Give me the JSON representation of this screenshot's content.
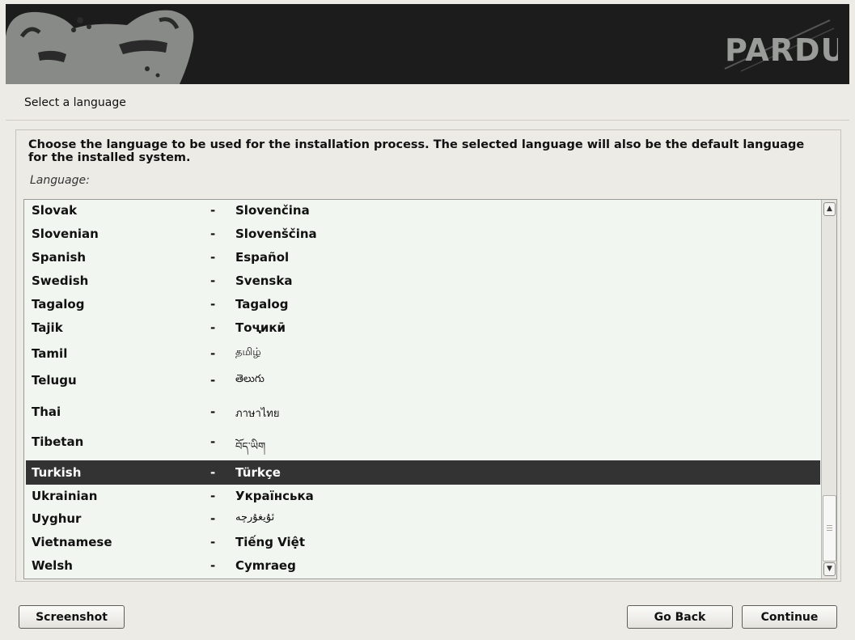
{
  "header": {
    "brand": "PARDUS"
  },
  "page": {
    "title": "Select a language"
  },
  "main": {
    "description": "Choose the language to be used for the installation process. The selected language will also be the default language for the installed system.",
    "list_label": "Language:"
  },
  "languages": [
    {
      "english": "Slovak",
      "dash": "-",
      "native": "Slovenčina"
    },
    {
      "english": "Slovenian",
      "dash": "-",
      "native": "Slovenščina"
    },
    {
      "english": "Spanish",
      "dash": "-",
      "native": "Español"
    },
    {
      "english": "Swedish",
      "dash": "-",
      "native": "Svenska"
    },
    {
      "english": "Tagalog",
      "dash": "-",
      "native": "Tagalog"
    },
    {
      "english": "Tajik",
      "dash": "-",
      "native": "Тоҷикӣ"
    },
    {
      "english": "Tamil",
      "dash": "-",
      "native": "தமிழ்"
    },
    {
      "english": "Telugu",
      "dash": "-",
      "native": "తెలుగు"
    },
    {
      "english": "Thai",
      "dash": "-",
      "native": "ภาษาไทย"
    },
    {
      "english": "Tibetan",
      "dash": "-",
      "native": "བོད་ཡིག"
    },
    {
      "english": "Turkish",
      "dash": "-",
      "native": "Türkçe"
    },
    {
      "english": "Ukrainian",
      "dash": "-",
      "native": "Українська"
    },
    {
      "english": "Uyghur",
      "dash": "-",
      "native": "ئۇيغۇرچە"
    },
    {
      "english": "Vietnamese",
      "dash": "-",
      "native": "Tiếng Việt"
    },
    {
      "english": "Welsh",
      "dash": "-",
      "native": "Cymraeg"
    }
  ],
  "selected_language": "Turkish",
  "buttons": {
    "screenshot": "Screenshot",
    "go_back": "Go Back",
    "continue": "Continue"
  },
  "colors": {
    "banner": "#1c1c1c",
    "selection": "#333333",
    "list_bg": "#f2f6f0"
  }
}
